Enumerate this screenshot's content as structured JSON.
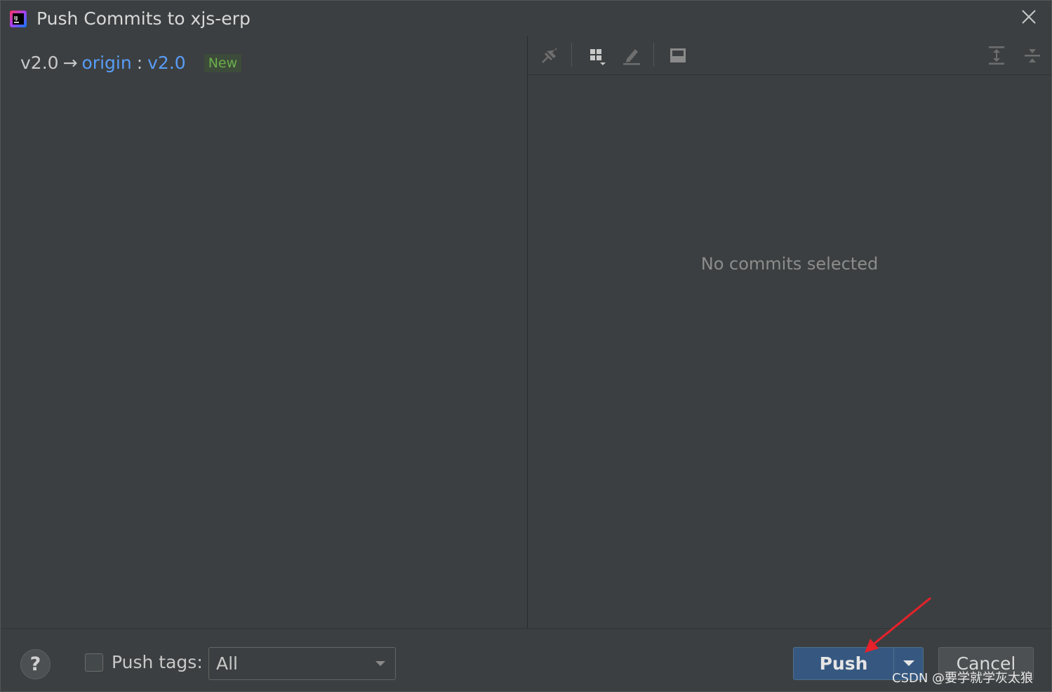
{
  "window": {
    "title": "Push Commits to xjs-erp",
    "app_icon": "intellij-idea-icon",
    "close_icon": "close-icon"
  },
  "branch": {
    "local": "v2.0",
    "arrow": "→",
    "remote": "origin",
    "separator": ":",
    "target": "v2.0",
    "badge": "New"
  },
  "details_toolbar": {
    "buttons": [
      {
        "name": "pin-icon"
      },
      {
        "name": "group-by-icon"
      },
      {
        "name": "edit-source-icon"
      },
      {
        "name": "show-details-icon"
      },
      {
        "name": "expand-all-icon"
      },
      {
        "name": "collapse-all-icon"
      }
    ]
  },
  "details": {
    "empty_text": "No commits selected"
  },
  "footer": {
    "help_label": "?",
    "push_tags_label": "Push tags:",
    "push_tags_checked": false,
    "tags_select_value": "All",
    "push_label": "Push",
    "cancel_label": "Cancel"
  },
  "watermark": "CSDN @要学就学灰太狼",
  "colors": {
    "background": "#3c3f41",
    "link": "#589df6",
    "badge_text": "#6ab04c",
    "primary_button": "#365880",
    "annotation_arrow": "#e8212b"
  }
}
